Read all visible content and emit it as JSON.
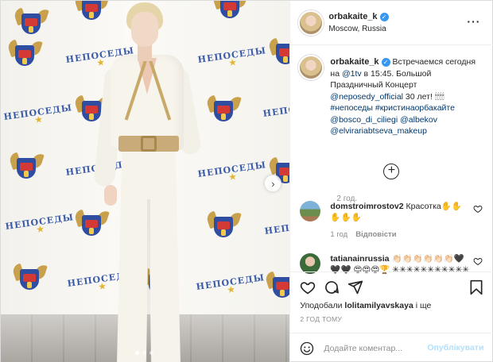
{
  "post": {
    "username": "orbakaite_k",
    "location": "Moscow, Russia",
    "more_icon": "more-options-icon",
    "verified_icon": "verified-badge-icon"
  },
  "photo": {
    "backdrop_logo_text": "НЕПОСЕДЫ",
    "next_icon": "chevron-right-icon",
    "carousel_total": 3,
    "carousel_active": 1
  },
  "caption": {
    "username": "orbakaite_k",
    "text_1": " Встречаемся сегодня на ",
    "mention_1": "@1tv",
    "text_2": " в 15:45. Большой Праздничный Концерт ",
    "mention_2": "@neposedy_official",
    "text_3": " 30 лет! 🕯🕯🕯🕯",
    "tag_1": "#непоседы",
    "tag_2": "#кристинаорбакайте",
    "mention_3": "@bosco_di_ciliegi",
    "mention_4": "@albekov",
    "mention_5": "@elvirariabtseva_makeup",
    "age": "2 год."
  },
  "comments": [
    {
      "username": "domstroimrostov2",
      "text": "Красотка✋✋ ✋✋✋",
      "age": "1 год",
      "reply_label": "Відповісти"
    },
    {
      "username": "tatianainrussia",
      "text": "👏🏻👏🏻👏🏻👏🏻👏🏻👏🏻🖤🖤🖤 😍😍😍🏆 ✳✳✳✳✳✳✳✳✳✳✳"
    }
  ],
  "engagement": {
    "liked_by_prefix": "Уподобали",
    "liked_by_user": "lolitamilyavskaya",
    "liked_by_suffix": "і ще",
    "time": "2 ГОД ТОМУ"
  },
  "comment_box": {
    "placeholder": "Додайте коментар...",
    "publish_label": "Опублікувати"
  },
  "colors": {
    "link": "#00376b",
    "verified": "#3897f0",
    "muted": "#8e8e8e",
    "publish_disabled": "#b2dffc"
  }
}
